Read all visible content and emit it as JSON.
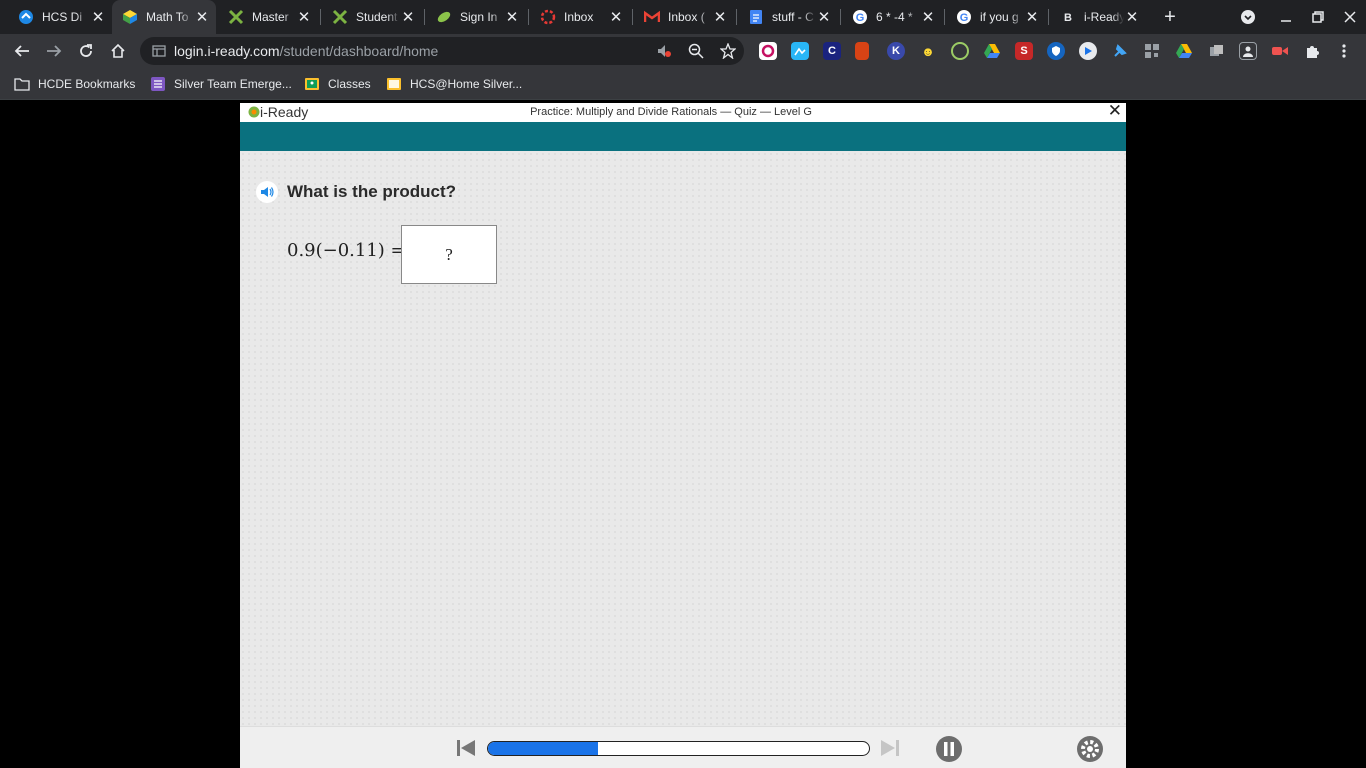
{
  "browser": {
    "tabs": [
      {
        "title": "HCS Di",
        "icon": "hcs-icon"
      },
      {
        "title": "Math To",
        "icon": "cube-icon"
      },
      {
        "title": "Master",
        "icon": "green-cross-icon"
      },
      {
        "title": "Student",
        "icon": "green-cross-icon"
      },
      {
        "title": "Sign In",
        "icon": "leaf-icon"
      },
      {
        "title": "Inbox",
        "icon": "ring-icon"
      },
      {
        "title": "Inbox (",
        "icon": "gmail-icon"
      },
      {
        "title": "stuff - C",
        "icon": "docs-icon"
      },
      {
        "title": "6 * -4 *",
        "icon": "google-icon"
      },
      {
        "title": "if you g",
        "icon": "google-icon"
      },
      {
        "title": "i-Ready",
        "icon": "iready-icon"
      }
    ],
    "active_tab": 1,
    "url_host": "login.i-ready.com",
    "url_path": "/student/dashboard/home",
    "bookmarks": [
      {
        "label": "HCDE Bookmarks",
        "icon": "folder-icon"
      },
      {
        "label": "Silver Team Emerge...",
        "icon": "list-icon"
      },
      {
        "label": "Classes",
        "icon": "classroom-icon"
      },
      {
        "label": "HCS@Home Silver...",
        "icon": "classroom-icon"
      }
    ]
  },
  "lesson": {
    "brand": "i-Ready",
    "title": "Practice: Multiply and Divide Rationals — Quiz — Level G",
    "close": "✕",
    "question": "What is the product?",
    "expression": "0.9(−0.11) =",
    "answer_placeholder": "?"
  },
  "footer": {
    "progress_fraction": 0.29
  },
  "colors": {
    "teal_bar": "#0a717f",
    "progress_fill": "#1a73e8"
  }
}
